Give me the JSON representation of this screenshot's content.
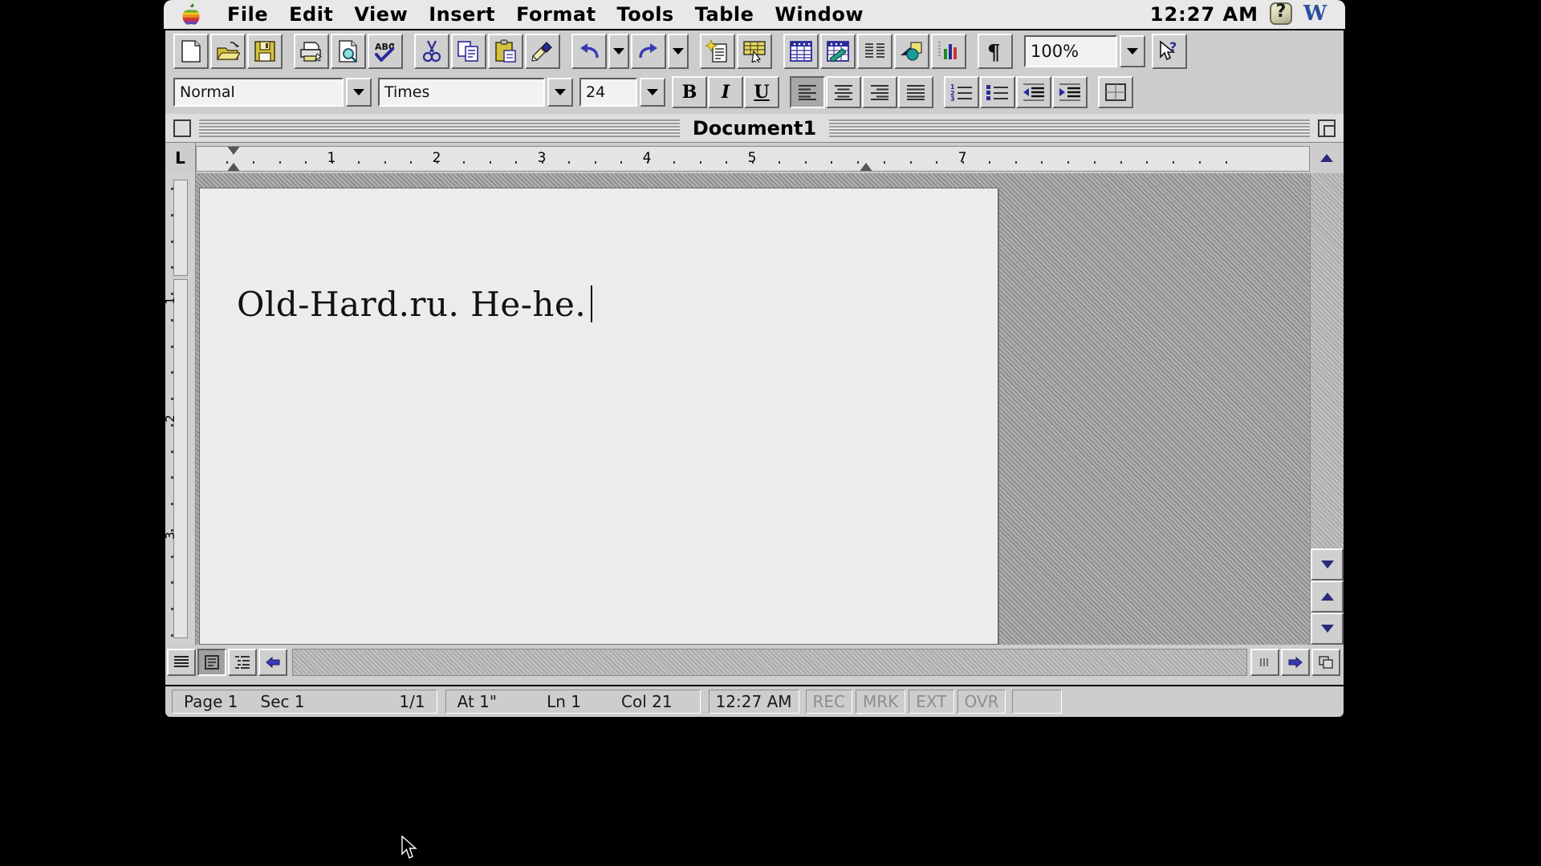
{
  "menubar": {
    "apple_icon": "apple-logo-icon",
    "items": [
      "File",
      "Edit",
      "View",
      "Insert",
      "Format",
      "Tools",
      "Table",
      "Window"
    ],
    "clock": "12:27 AM",
    "right_icons": [
      {
        "name": "help-balloon-icon",
        "label": "?"
      },
      {
        "name": "word-application-icon",
        "label": "W"
      }
    ]
  },
  "standard_toolbar": {
    "groups": [
      [
        {
          "name": "new-document-button",
          "icon": "new-document-icon",
          "tip": "New"
        },
        {
          "name": "open-button",
          "icon": "open-folder-icon",
          "tip": "Open"
        },
        {
          "name": "save-button",
          "icon": "floppy-disk-icon",
          "tip": "Save"
        }
      ],
      [
        {
          "name": "print-button",
          "icon": "printer-icon",
          "tip": "Print"
        },
        {
          "name": "print-preview-button",
          "icon": "print-preview-icon",
          "tip": "Print Preview"
        },
        {
          "name": "spelling-button",
          "icon": "abc-checkmark-icon",
          "tip": "Spelling"
        }
      ],
      [
        {
          "name": "cut-button",
          "icon": "scissors-icon",
          "tip": "Cut"
        },
        {
          "name": "copy-button",
          "icon": "copy-pages-icon",
          "tip": "Copy"
        },
        {
          "name": "paste-button",
          "icon": "clipboard-icon",
          "tip": "Paste"
        },
        {
          "name": "format-painter-button",
          "icon": "paintbrush-icon",
          "tip": "Format Painter"
        }
      ],
      [
        {
          "name": "undo-button",
          "icon": "undo-arrow-icon",
          "tip": "Undo"
        },
        {
          "name": "undo-dropdown-button",
          "icon": "chevron-down-icon",
          "tip": "Undo History"
        },
        {
          "name": "redo-button",
          "icon": "redo-arrow-icon",
          "tip": "Redo"
        },
        {
          "name": "redo-dropdown-button",
          "icon": "chevron-down-icon",
          "tip": "Redo History"
        }
      ],
      [
        {
          "name": "autoformat-button",
          "icon": "autoformat-sparkle-icon",
          "tip": "AutoFormat"
        },
        {
          "name": "autosum-button",
          "icon": "table-pencil-icon",
          "tip": "AutoSum"
        }
      ],
      [
        {
          "name": "insert-table-button",
          "icon": "grid-table-icon",
          "tip": "Insert Table"
        },
        {
          "name": "insert-excel-table-button",
          "icon": "excel-table-icon",
          "tip": "Insert Microsoft Excel Worksheet"
        },
        {
          "name": "columns-button",
          "icon": "columns-icon",
          "tip": "Columns"
        },
        {
          "name": "drawing-button",
          "icon": "drawing-shapes-icon",
          "tip": "Drawing"
        },
        {
          "name": "chart-button",
          "icon": "bar-chart-icon",
          "tip": "Insert Chart"
        }
      ],
      [
        {
          "name": "show-paragraph-marks-button",
          "icon": "pilcrow-icon",
          "tip": "Show/Hide ¶"
        }
      ]
    ],
    "zoom": {
      "name": "zoom-combo",
      "value": "100%",
      "dropdown": "chevron-down-icon"
    },
    "help": {
      "name": "help-pointer-button",
      "icon": "arrow-question-icon"
    }
  },
  "formatting_toolbar": {
    "style": {
      "label": "Style",
      "value": "Normal"
    },
    "font": {
      "label": "Font",
      "value": "Times"
    },
    "size": {
      "label": "Font Size",
      "value": "24"
    },
    "bold": {
      "label": "B",
      "active": false
    },
    "italic": {
      "label": "I",
      "active": false
    },
    "underline": {
      "label": "U",
      "active": false
    },
    "align": [
      {
        "name": "align-left-button",
        "icon": "align-left-icon",
        "active": true
      },
      {
        "name": "align-center-button",
        "icon": "align-center-icon",
        "active": false
      },
      {
        "name": "align-right-button",
        "icon": "align-right-icon",
        "active": false
      },
      {
        "name": "align-justify-button",
        "icon": "align-justify-icon",
        "active": false
      }
    ],
    "lists": [
      {
        "name": "numbered-list-button",
        "icon": "numbered-list-icon"
      },
      {
        "name": "bulleted-list-button",
        "icon": "bulleted-list-icon"
      },
      {
        "name": "decrease-indent-button",
        "icon": "decrease-indent-icon"
      },
      {
        "name": "increase-indent-button",
        "icon": "increase-indent-icon"
      }
    ],
    "borders": {
      "name": "borders-button",
      "icon": "borders-grid-icon"
    }
  },
  "document_window": {
    "title": "Document1",
    "close_box": "close-box-icon",
    "zoom_box": "zoom-box-icon",
    "tab_selector": "L",
    "ruler": {
      "numbers": [
        "1",
        "2",
        "3",
        "4",
        "5",
        "7"
      ],
      "left_indent_marker": "first-line-indent-marker",
      "right_indent_marker": "right-indent-marker"
    },
    "vertical_ruler_numbers": [
      "1",
      "2",
      "3"
    ],
    "text": "Old-Hard.ru. He-he.",
    "view_buttons": [
      {
        "name": "normal-view-button",
        "icon": "normal-view-icon",
        "active": false
      },
      {
        "name": "page-layout-view-button",
        "icon": "page-layout-view-icon",
        "active": true
      },
      {
        "name": "outline-view-button",
        "icon": "outline-view-icon",
        "active": false
      },
      {
        "name": "scroll-left-button",
        "icon": "left-arrow-icon",
        "active": false
      }
    ]
  },
  "status_bar": {
    "page_label": "Page",
    "page_value": "1",
    "sec_label": "Sec",
    "sec_value": "1",
    "pages": "1/1",
    "at_label": "At",
    "at_value": "1\"",
    "ln_label": "Ln",
    "ln_value": "1",
    "col_label": "Col",
    "col_value": "21",
    "clock": "12:27 AM",
    "modes": [
      "REC",
      "MRK",
      "EXT",
      "OVR"
    ]
  },
  "colors": {
    "chrome": "#cdcdcd",
    "menubar": "#e8e8e8",
    "page": "#ececec",
    "accent_blue": "#2a2a7a",
    "desk": "#9f9f9f"
  }
}
